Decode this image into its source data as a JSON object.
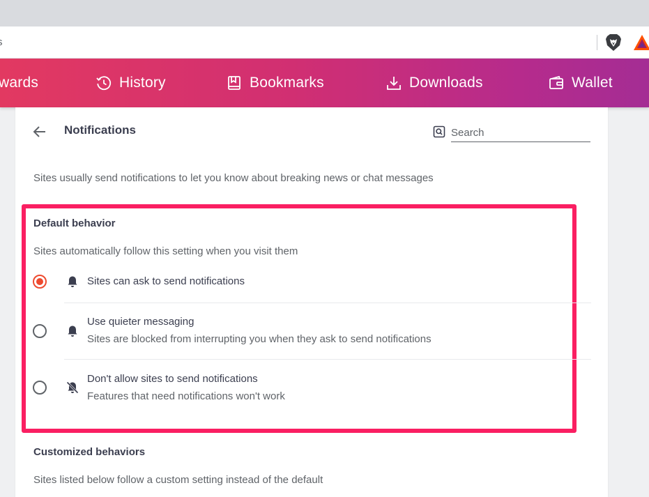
{
  "browser": {
    "url_fragment": "s",
    "icons": [
      "brave-lion-icon",
      "brave-rewards-triangle-icon"
    ]
  },
  "nav": {
    "items": [
      {
        "label": "wards",
        "icon": "rewards-icon"
      },
      {
        "label": "History",
        "icon": "history-clock-icon"
      },
      {
        "label": "Bookmarks",
        "icon": "bookmark-icon"
      },
      {
        "label": "Downloads",
        "icon": "download-icon"
      },
      {
        "label": "Wallet",
        "icon": "wallet-icon"
      }
    ],
    "gradient": [
      "#e23961",
      "#a42d94"
    ]
  },
  "header": {
    "title": "Notifications",
    "search_placeholder": "Search"
  },
  "description": "Sites usually send notifications to let you know about breaking news or chat messages",
  "default_behavior": {
    "title": "Default behavior",
    "subtitle": "Sites automatically follow this setting when you visit them",
    "options": [
      {
        "label": "Sites can ask to send notifications",
        "sub": "",
        "checked": true,
        "icon": "bell-icon"
      },
      {
        "label": "Use quieter messaging",
        "sub": "Sites are blocked from interrupting you when they ask to send notifications",
        "checked": false,
        "icon": "bell-icon"
      },
      {
        "label": "Don't allow sites to send notifications",
        "sub": "Features that need notifications won't work",
        "checked": false,
        "icon": "bell-off-icon"
      }
    ],
    "highlight_color": "#fa1f62"
  },
  "customized_behaviors": {
    "title": "Customized behaviors",
    "subtitle": "Sites listed below follow a custom setting instead of the default"
  },
  "colors": {
    "accent": "#ee4a2f"
  }
}
